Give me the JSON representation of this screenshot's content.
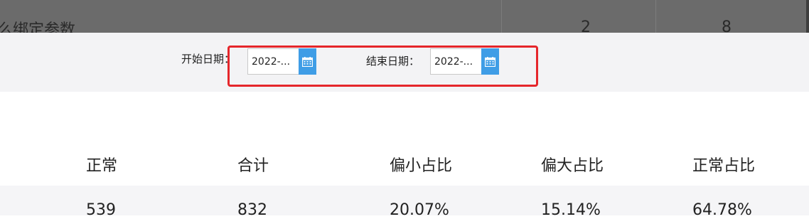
{
  "background": {
    "partial_title": "么绑定参数",
    "cells": [
      "2",
      "8"
    ]
  },
  "filter": {
    "start_label": "开始日期：",
    "start_value": "2022-...",
    "end_label": "结束日期：",
    "end_value": "2022-..."
  },
  "table": {
    "headers": [
      "正常",
      "合计",
      "偏小占比",
      "偏大占比",
      "正常占比"
    ],
    "rows": [
      [
        "539",
        "832",
        "20.07%",
        "15.14%",
        "64.78%"
      ]
    ]
  },
  "colors": {
    "accent": "#3f9de6",
    "highlight": "#e5262b"
  }
}
